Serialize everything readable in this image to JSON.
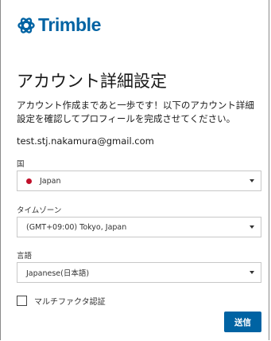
{
  "brand": {
    "name": "Trimble",
    "color": "#0063a3"
  },
  "page": {
    "title": "アカウント詳細設定",
    "description": "アカウント作成まであと一歩です！以下のアカウント詳細設定を確認してプロフィールを完成させてください。",
    "email": "test.stj.nakamura@gmail.com"
  },
  "fields": {
    "country": {
      "label": "国",
      "value": "Japan",
      "flag_icon": "japan-flag-icon"
    },
    "timezone": {
      "label": "タイムゾーン",
      "value": "(GMT+09:00) Tokyo, Japan"
    },
    "language": {
      "label": "言語",
      "value": "Japanese(日本語)"
    }
  },
  "mfa": {
    "label": "マルチファクタ認証",
    "checked": false
  },
  "actions": {
    "submit_label": "送信",
    "submit_color": "#0063a3"
  }
}
